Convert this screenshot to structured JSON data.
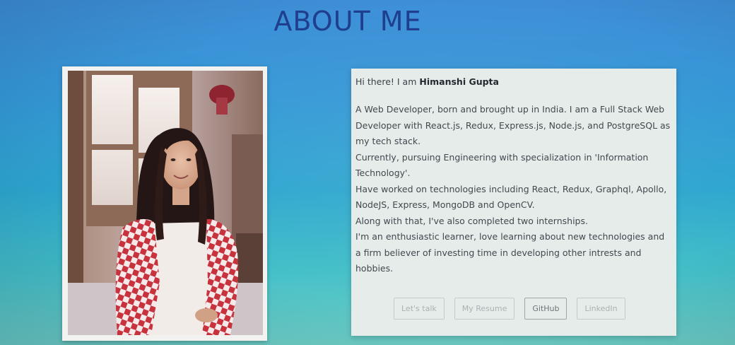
{
  "section": {
    "title": "ABOUT ME"
  },
  "bio": {
    "greeting_prefix": "Hi there! I am ",
    "name": "Himanshi Gupta",
    "paragraphs": [
      "A Web Developer, born and brought up in India. I am a Full Stack Web Developer with React.js, Redux, Express.js, Node.js, and PostgreSQL as my tech stack.",
      "Currently, pursuing Engineering with specialization in 'Information Technology'.",
      "Have worked on technologies including React, Redux, Graphql, Apollo, NodeJS, Express, MongoDB and OpenCV.",
      "Along with that, I've also completed two internships.",
      "I'm an enthusiastic learner, love learning about new technologies and a firm believer of investing time in developing other intrests and hobbies."
    ]
  },
  "buttons": {
    "lets_talk": "Let's talk",
    "resume": "My Resume",
    "github": "GitHub",
    "linkedin": "LinkedIn"
  },
  "colors": {
    "title": "#1f3e8e",
    "card_bg": "#e6ecea",
    "page_bg_top": "#3f8fd8",
    "page_bg_bottom": "#70d0c6"
  }
}
